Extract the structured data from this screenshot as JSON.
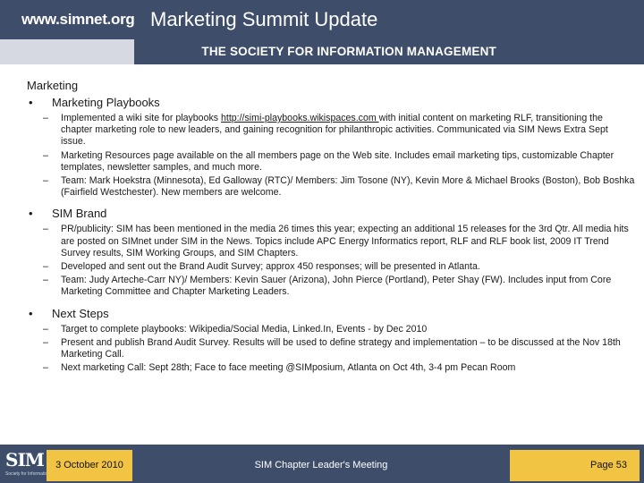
{
  "header": {
    "site": "www.simnet.org",
    "title": "Marketing Summit Update",
    "society": "THE SOCIETY FOR INFORMATION MANAGEMENT"
  },
  "section": "Marketing",
  "bullets": [
    {
      "label": "Marketing Playbooks",
      "items": [
        {
          "before": "Implemented a wiki site for playbooks ",
          "link": "http://simi-playbooks.wikispaces.com ",
          "after": " with initial content on marketing RLF, transitioning the chapter marketing role to new leaders, and gaining recognition for philanthropic activities. Communicated via SIM News Extra Sept issue."
        },
        {
          "text": "Marketing Resources page available on the all members page on the Web site. Includes email marketing tips, customizable Chapter templates, newsletter samples, and much more."
        },
        {
          "text": "Team: Mark Hoekstra (Minnesota), Ed Galloway (RTC)/ Members: Jim Tosone (NY), Kevin More & Michael Brooks (Boston), Bob Boshka (Fairfield Westchester). New members are welcome."
        }
      ]
    },
    {
      "label": "SIM Brand",
      "items": [
        {
          "text": "PR/publicity: SIM has been mentioned in the media 26 times this year; expecting an additional 15 releases for the 3rd Qtr. All media hits are posted on SIMnet under SIM in the News. Topics include APC Energy Informatics report, RLF and RLF book list, 2009 IT Trend Survey results, SIM Working Groups, and SIM Chapters."
        },
        {
          "text": "Developed and sent out the Brand Audit Survey; approx 450 responses; will be presented in Atlanta."
        },
        {
          "text": "Team: Judy Arteche-Carr NY)/ Members: Kevin Sauer (Arizona), John Pierce (Portland), Peter Shay (FW). Includes input from Core Marketing Committee and Chapter Marketing Leaders."
        }
      ]
    },
    {
      "label": "Next Steps",
      "items": [
        {
          "text": "Target to complete playbooks: Wikipedia/Social Media, Linked.In, Events - by Dec 2010"
        },
        {
          "text": "Present and publish Brand Audit Survey. Results will be used to define strategy and implementation – to be discussed at the Nov 18th Marketing Call."
        },
        {
          "text": "Next marketing Call: Sept 28th; Face to face meeting @SIMposium, Atlanta on Oct 4th, 3-4 pm Pecan Room"
        }
      ]
    }
  ],
  "footer": {
    "logo": "SIM",
    "logo_sub": "Society for Information Management",
    "date": "3 October 2010",
    "meeting": "SIM Chapter Leader's Meeting",
    "page": "Page 53"
  },
  "colors": {
    "navy": "#3e4e6a",
    "gold": "#f2c443"
  }
}
